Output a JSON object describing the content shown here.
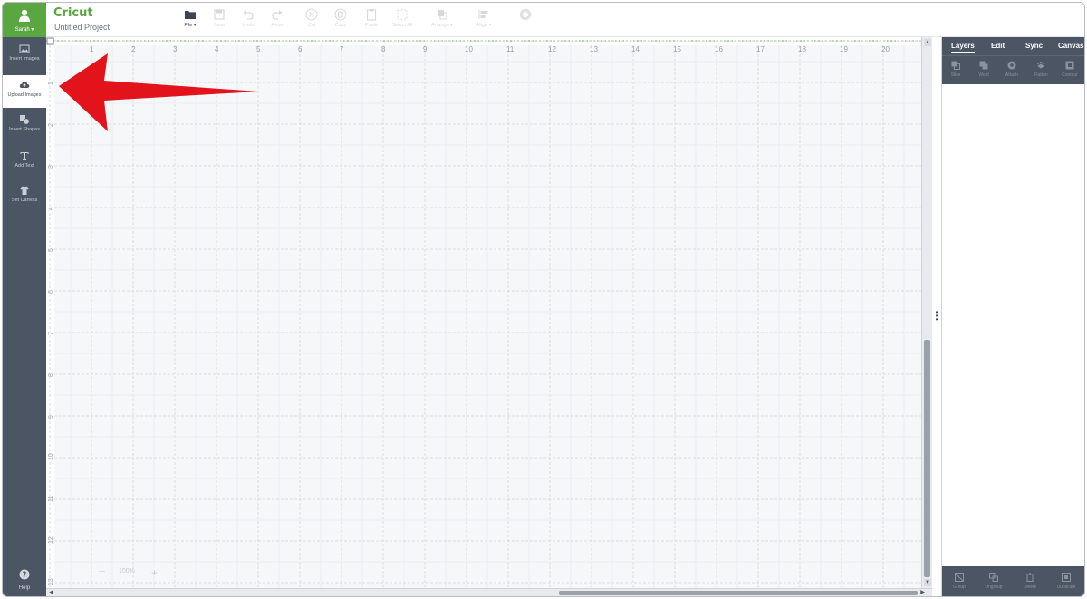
{
  "app": {
    "logo": "Cricut",
    "project_title": "Untitled Project",
    "accent_color": "#5aa641",
    "sidebar_color": "#4b5563"
  },
  "user": {
    "name": "Sarah ▾",
    "icon": "user-icon"
  },
  "sidebar": {
    "tools": [
      {
        "label": "Insert Images",
        "icon": "image-icon"
      },
      {
        "label": "Upload Images",
        "icon": "cloud-upload-icon"
      },
      {
        "label": "Insert Shapes",
        "icon": "shapes-icon"
      },
      {
        "label": "Add Text",
        "icon": "text-icon"
      },
      {
        "label": "Set Canvas",
        "icon": "shirt-icon"
      }
    ],
    "help": "Help"
  },
  "toolbar": {
    "file": "File ▾",
    "items": [
      "Save",
      "Undo",
      "Redo",
      "Cut",
      "Copy",
      "Paste",
      "Select All",
      "Arrange ▾",
      "Align ▾"
    ]
  },
  "canvas": {
    "ruler_top": [
      "1",
      "2",
      "3",
      "4",
      "5",
      "6",
      "7",
      "8",
      "9",
      "10",
      "11",
      "12",
      "13",
      "14",
      "15",
      "16",
      "17",
      "18",
      "19",
      "20"
    ],
    "ruler_left": [
      "1",
      "2",
      "3",
      "4",
      "5",
      "6",
      "7",
      "8",
      "9",
      "10",
      "11",
      "12",
      "13"
    ],
    "zoom": {
      "minus": "—",
      "value": "100%",
      "plus": "+"
    }
  },
  "right_panel": {
    "tabs": [
      "Layers",
      "Edit",
      "Sync",
      "Canvas"
    ],
    "active_tab": "Layers",
    "top_tools": [
      "Slice",
      "Weld",
      "Attach",
      "Flatten",
      "Contour"
    ],
    "bottom_tools": [
      "Group",
      "Ungroup",
      "Delete",
      "Duplicate"
    ]
  },
  "annotation": {
    "arrow_color": "#e3131b",
    "points_to": "Upload Images"
  }
}
